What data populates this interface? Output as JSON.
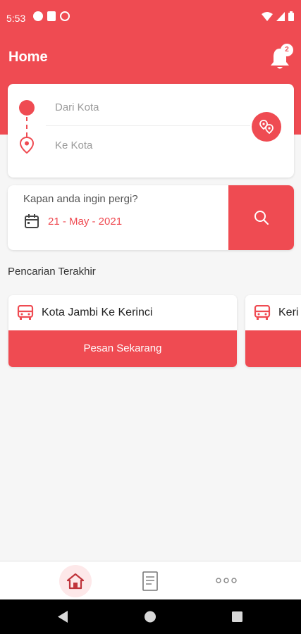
{
  "status_bar": {
    "time": "5:53"
  },
  "header": {
    "title": "Home",
    "notification_count": "2",
    "notification_icon": "bell-icon"
  },
  "route": {
    "from_placeholder": "Dari Kota",
    "to_placeholder": "Ke Kota",
    "swap_icon": "location-pins-icon"
  },
  "date": {
    "question": "Kapan anda ingin pergi?",
    "value": "21 - May - 2021",
    "search_icon": "search-icon"
  },
  "recent": {
    "title": "Pencarian Terakhir",
    "items": [
      {
        "route": "Kota Jambi Ke Kerinci",
        "button": "Pesan Sekarang"
      },
      {
        "route": "Keri",
        "button": ""
      }
    ]
  },
  "bottom_nav": {
    "items": [
      {
        "icon": "home-icon",
        "active": true
      },
      {
        "icon": "document-icon",
        "active": false
      },
      {
        "icon": "more-icon",
        "active": false
      }
    ]
  },
  "colors": {
    "accent": "#ef4b52",
    "background": "#f6f6f6"
  }
}
